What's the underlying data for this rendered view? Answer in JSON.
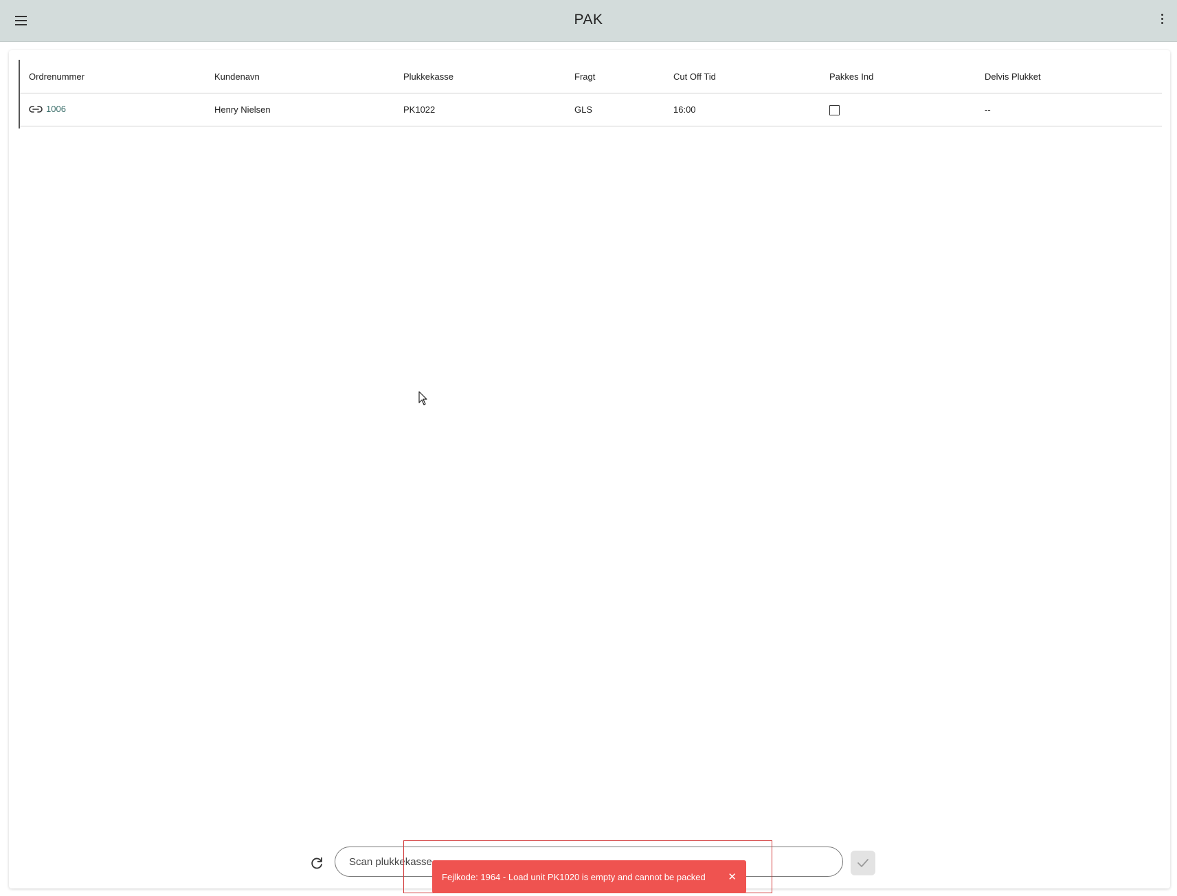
{
  "appbar": {
    "title": "PAK",
    "menu_icon": "menu-icon",
    "more_icon": "more-vert-icon"
  },
  "table": {
    "headers": [
      "Ordrenummer",
      "Kundenavn",
      "Plukkekasse",
      "Fragt",
      "Cut Off Tid",
      "Pakkes Ind",
      "Delvis Plukket"
    ],
    "rows": [
      {
        "order": "1006",
        "customer": "Henry Nielsen",
        "box": "PK1022",
        "freight": "GLS",
        "cutoff": "16:00",
        "pack_in": false,
        "partial": "--"
      }
    ]
  },
  "scan": {
    "placeholder": "Scan plukkekasse",
    "value": ""
  },
  "toast": {
    "message": "Fejlkode: 1964 - Load unit PK1020 is empty and cannot be packed",
    "close": "✕"
  },
  "colors": {
    "appbar": "#d3dcdb",
    "toast": "#ef5350",
    "link": "#3c6f6b",
    "highlight": "#d23a3a"
  }
}
